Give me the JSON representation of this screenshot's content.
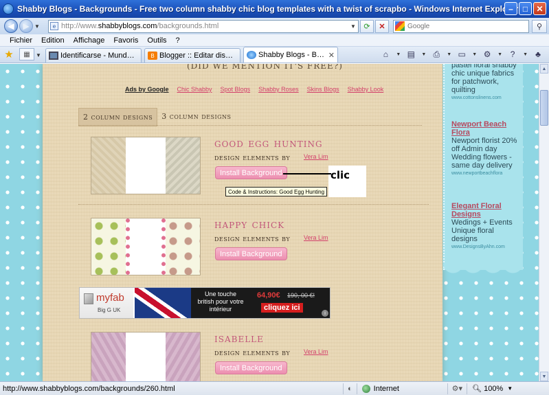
{
  "window": {
    "title": "Shabby Blogs - Backgrounds - Free two column shabby chic blog templates with a twist of scrapbo - Windows Internet Explorer"
  },
  "address": {
    "url_prefix": "http://www.",
    "url_domain": "shabbyblogs.com",
    "url_path": "/backgrounds.html",
    "search_placeholder": "Google"
  },
  "menu": [
    "Fichier",
    "Edition",
    "Affichage",
    "Favoris",
    "Outils",
    "?"
  ],
  "tabs": [
    {
      "label": "Identificarse - MundoReceta...",
      "icon": "monitor-icon"
    },
    {
      "label": "Blogger :: Editar diseño",
      "icon": "blogger-icon"
    },
    {
      "label": "Shabby Blogs - Backgrou...",
      "icon": "ie-icon",
      "active": true
    }
  ],
  "page": {
    "free_line": "(DID WE MENTION IT'S FREE?)",
    "ads_label": "Ads by Google",
    "ad_links": [
      "Chic Shabby",
      "Spot Blogs",
      "Shabby Roses",
      "Skins Blogs",
      "Shabby Look"
    ],
    "design_tabs": [
      "2 column designs",
      "3 column designs"
    ],
    "items": [
      {
        "title": "good egg hunting",
        "elements_label": "design elements by",
        "author": "Vera Lim",
        "button": "Install Background"
      },
      {
        "title": "happy chick",
        "elements_label": "design elements by",
        "author": "Vera Lim",
        "button": "Install Background"
      },
      {
        "title": "isabelle",
        "elements_label": "design elements by",
        "author": "Vera Lim",
        "button": "Install Background"
      }
    ],
    "tooltip": "Code & Instructions: Good Egg Hunting",
    "annotation": "clic",
    "banner": {
      "brand": "myfab",
      "brand_sub": "Big G UK",
      "tagline": "Une touche british pour votre intérieur",
      "price_new": "64,90€",
      "price_old": "190, 00 €!",
      "cta": "cliquez ici"
    }
  },
  "sidebar": {
    "top_text": "pastel floral shabby chic unique fabrics for patchwork, quilting",
    "top_url": "www.cottonslinens.com",
    "ad2_title": "Newport Beach Flora",
    "ad2_text": "Newport florist 20% off Admin day Wedding flowers - same day delivery",
    "ad2_url": "www.newportbeachflora",
    "ad3_title": "Elegant Floral Designs",
    "ad3_text": "Wedings + Events Unique floral designs",
    "ad3_url": "www.DesignsByAhn.com"
  },
  "status": {
    "url": "http://www.shabbyblogs.com/backgrounds/260.html",
    "zone": "Internet",
    "zoom": "100%"
  },
  "colors": {
    "accent_pink": "#c2577a",
    "link_pink": "#d3406b",
    "sidebar_blue": "#a9e3ec"
  }
}
